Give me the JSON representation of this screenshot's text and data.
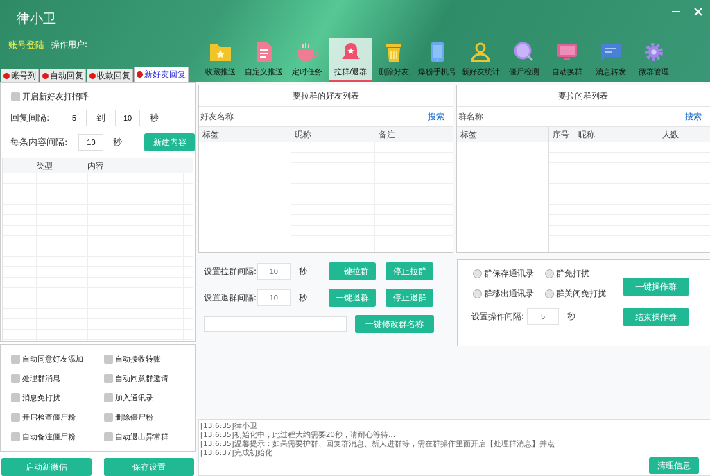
{
  "window": {
    "title": "律小卫"
  },
  "account": {
    "login_link": "账号登陆",
    "user_label": "操作用户:"
  },
  "toolbar": [
    {
      "label": "收藏推送",
      "selected": false
    },
    {
      "label": "自定义推送",
      "selected": false
    },
    {
      "label": "定时任务",
      "selected": false
    },
    {
      "label": "拉群/退群",
      "selected": true
    },
    {
      "label": "删除好友",
      "selected": false
    },
    {
      "label": "爆粉手机号",
      "selected": false
    },
    {
      "label": "新好友统计",
      "selected": false
    },
    {
      "label": "僵尸检测",
      "selected": false
    },
    {
      "label": "自动换群",
      "selected": false
    },
    {
      "label": "消息转发",
      "selected": false
    },
    {
      "label": "微群管理",
      "selected": false
    }
  ],
  "left_tabs": [
    {
      "label": "账号列",
      "selected": false
    },
    {
      "label": "自动回复",
      "selected": false
    },
    {
      "label": "收款回复",
      "selected": false
    },
    {
      "label": "新好友回复",
      "selected": true
    }
  ],
  "greeting": {
    "label": "开启新好友打招呼",
    "checked": false
  },
  "reply_interval": {
    "label": "回复间隔:",
    "from": "5",
    "to_label": "到",
    "to": "10",
    "unit": "秒"
  },
  "content_interval": {
    "label": "每条内容间隔:",
    "value": "10",
    "unit": "秒"
  },
  "new_content_button": "新建内容",
  "content_table": {
    "columns": [
      "类型",
      "内容"
    ]
  },
  "options": [
    {
      "label": "自动同意好友添加",
      "checked": false
    },
    {
      "label": "自动接收转账",
      "checked": false
    },
    {
      "label": "处理群消息",
      "checked": false
    },
    {
      "label": "自动同意群邀请",
      "checked": false
    },
    {
      "label": "消息免打扰",
      "checked": false
    },
    {
      "label": "加入通讯录",
      "checked": false
    },
    {
      "label": "开启检查僵尸粉",
      "checked": false
    },
    {
      "label": "删除僵尸粉",
      "checked": false
    },
    {
      "label": "自动备注僵尸粉",
      "checked": false
    },
    {
      "label": "自动退出异常群",
      "checked": false
    }
  ],
  "bottom_buttons": [
    "启动新微信",
    "保存设置"
  ],
  "friends_panel": {
    "title": "要拉群的好友列表",
    "search_placeholder": "好友名称",
    "search_button": "搜索",
    "columns": [
      "标签",
      "昵称",
      "备注"
    ]
  },
  "groups_panel": {
    "title": "要拉的群列表",
    "search_placeholder": "群名称",
    "search_button": "搜索",
    "columns": [
      "标签",
      "序号",
      "昵称",
      "人数"
    ]
  },
  "interval_rows": [
    {
      "label": "设置拉群间隔:",
      "value": "10",
      "unit": "秒",
      "buttons": [
        "一键拉群",
        "停止拉群"
      ]
    },
    {
      "label": "设置退群间隔:",
      "value": "10",
      "unit": "秒",
      "buttons": [
        "一键退群",
        "停止退群"
      ]
    }
  ],
  "rename_button": "一键修改群名称",
  "group_ops": {
    "radios": [
      {
        "label": "群保存通讯录",
        "selected": false
      },
      {
        "label": "群免打扰",
        "selected": false
      },
      {
        "label": "群移出通讯录",
        "selected": false
      },
      {
        "label": "群关闭免打扰",
        "selected": false
      }
    ],
    "interval_label": "设置操作间隔:",
    "interval": "5",
    "unit": "秒",
    "buttons": [
      "一键操作群",
      "结束操作群"
    ]
  },
  "log": {
    "lines": [
      "[13:6:35]律小卫",
      "[13:6:35]初始化中，此过程大约需要20秒，请耐心等待...",
      "[13:6:35]温馨提示：如果需要护群、回复群消息、新人进群等，需在群操作里面开启【处理群消息】并点",
      "[13:6:37]完成初始化"
    ],
    "clear_button": "清理信息"
  }
}
